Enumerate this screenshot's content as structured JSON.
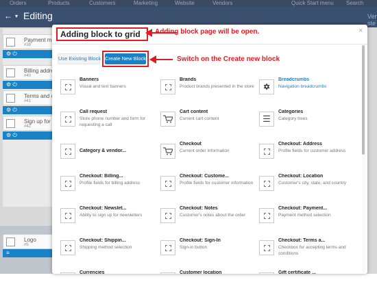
{
  "background": {
    "topbar_items": [
      "Orders",
      "Products",
      "Customers",
      "Marketing",
      "Website",
      "Vendors"
    ],
    "quick_menu": "Quick Start menu",
    "search": "Search",
    "page_title": "Editing",
    "cards": [
      {
        "title": "Payment meth",
        "sub": "#39"
      },
      {
        "title": "Billing addres",
        "sub": "#40"
      },
      {
        "title": "Terms and co",
        "sub": "#41"
      },
      {
        "title": "Sign up for n",
        "sub": "#42"
      }
    ],
    "lower_card": {
      "title": "Logo",
      "sub": "#5"
    },
    "right_link": "Ven-ste"
  },
  "dialog": {
    "title": "Adding block to grid",
    "close": "×",
    "use_existing": "Use Existing Block",
    "create_new": "Create New Block"
  },
  "annotations": {
    "page_open": "Adding block page will be open.",
    "switch_create": "Switch on the Create new block"
  },
  "blocks": [
    {
      "name": "Banners",
      "desc": "Visual and text banners",
      "icon": "dashed-box-icon"
    },
    {
      "name": "Brands",
      "desc": "Product brands presented in the store",
      "icon": "dashed-box-icon"
    },
    {
      "name": "Breadcrumbs",
      "desc": "Navigation breadcrumbs",
      "icon": "signpost-icon",
      "highlight": true
    },
    {
      "name": "Call request",
      "desc": "Store phone number and form for requesting a call",
      "icon": "dashed-box-icon"
    },
    {
      "name": "Cart content",
      "desc": "Current cart content",
      "icon": "cart-icon"
    },
    {
      "name": "Categories",
      "desc": "Category trees",
      "icon": "list-icon"
    },
    {
      "name": "Category & vendor...",
      "desc": "",
      "icon": "dashed-box-icon"
    },
    {
      "name": "Checkout",
      "desc": "Current order information",
      "icon": "cart-icon"
    },
    {
      "name": "Checkout: Address",
      "desc": "Profile fields for customer address",
      "icon": "dashed-box-icon"
    },
    {
      "name": "Checkout: Billing...",
      "desc": "Profile fields for billing address",
      "icon": "dashed-box-icon"
    },
    {
      "name": "Checkout: Custome...",
      "desc": "Profile fields for customer information",
      "icon": "dashed-box-icon"
    },
    {
      "name": "Checkout: Location",
      "desc": "Customer's city, state, and country",
      "icon": "dashed-box-icon"
    },
    {
      "name": "Checkout: Newslet...",
      "desc": "Ability to sign up for newsletters",
      "icon": "dashed-box-icon"
    },
    {
      "name": "Checkout: Notes",
      "desc": "Customer's notes about the order",
      "icon": "dashed-box-icon"
    },
    {
      "name": "Checkout: Payment...",
      "desc": "Payment method selection",
      "icon": "dashed-box-icon"
    },
    {
      "name": "Checkout: Shippin...",
      "desc": "Shipping method selection",
      "icon": "dashed-box-icon"
    },
    {
      "name": "Checkout: Sign-In",
      "desc": "Sign-in button",
      "icon": "dashed-box-icon"
    },
    {
      "name": "Checkout: Terms a...",
      "desc": "Checkbox for accepting terms and conditions",
      "icon": "dashed-box-icon"
    },
    {
      "name": "Currencies",
      "desc": "Currency selector",
      "icon": "dollar-icon"
    },
    {
      "name": "Customer location",
      "desc": "Current city and city selection form",
      "icon": "dashed-box-icon"
    },
    {
      "name": "Gift certificate ...",
      "desc": "Gift certificate input and validation",
      "icon": "dashed-box-icon"
    }
  ],
  "colors": {
    "accent_blue": "#1a7fc4",
    "annotation_red": "#e11b22"
  }
}
